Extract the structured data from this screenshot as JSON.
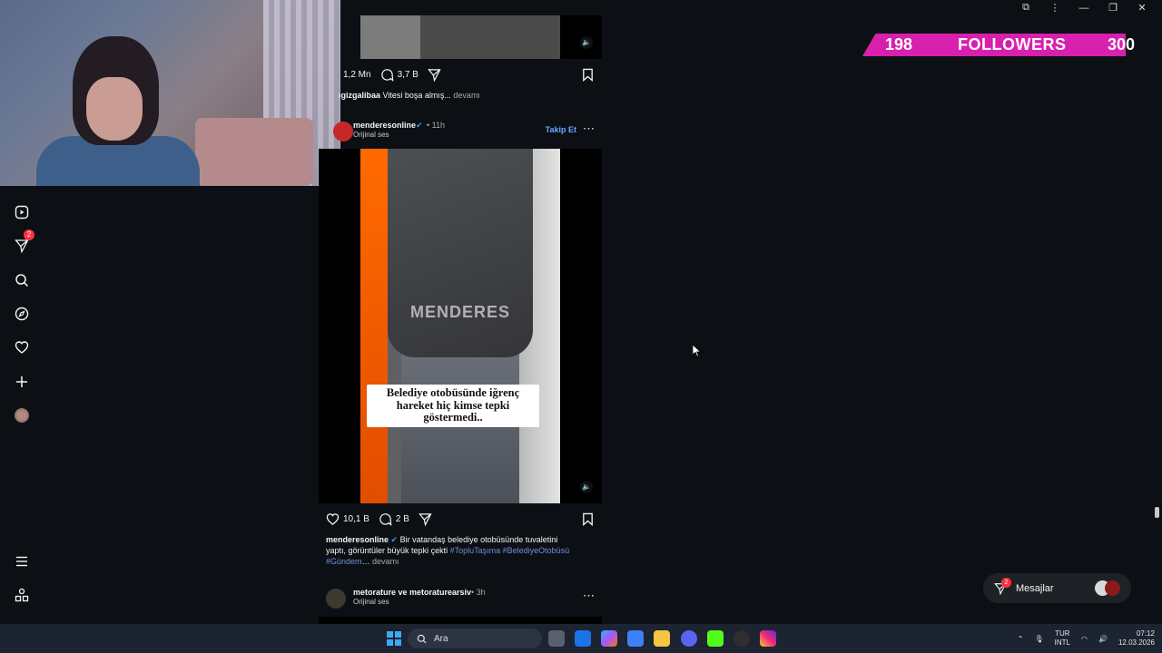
{
  "window_controls": {
    "extensions_icon": "puzzle-icon",
    "menu_icon": "kebab-icon",
    "minimize": "—",
    "restore": "❐",
    "close": "✕"
  },
  "followers_goal": {
    "current": "198",
    "label": "FOLLOWERS",
    "goal": "300",
    "bar_color": "#d81fae"
  },
  "left_nav": {
    "items": [
      {
        "name": "reels-icon"
      },
      {
        "name": "direct-icon",
        "badge": "2"
      },
      {
        "name": "search-icon"
      },
      {
        "name": "explore-icon"
      },
      {
        "name": "notifications-heart-icon"
      },
      {
        "name": "create-plus-icon"
      },
      {
        "name": "profile-avatar"
      }
    ],
    "bottom": [
      {
        "name": "more-menu-icon"
      },
      {
        "name": "also-from-meta-icon"
      }
    ]
  },
  "post_prev": {
    "likes": "1,2 Mn",
    "comments": "3,7 B",
    "caption_user": "ıgizgalibaa",
    "caption_text": "Vitesi boşa almış...",
    "more": "devamı"
  },
  "post_main": {
    "username": "menderesonline",
    "verified": true,
    "time": "11h",
    "audio": "Orijinal ses",
    "follow_label": "Takip Et",
    "watermark": "MENDERES",
    "sticker_text": "Belediye otobüsünde iğrenç hareket hiç kimse tepki göstermedi..",
    "likes": "10,1 B",
    "comments": "2 B",
    "caption_user": "menderesonline",
    "caption_text": "Bir vatandaş belediye otobüsünde tuvaletini yaptı, görüntüler büyük tepki çekti",
    "hashtags": "#TopluTaşıma #BelediyeOtobüsü #Gündem",
    "more": "devamı"
  },
  "post_next": {
    "users": "metorature ve metoraturearsiv",
    "time": "3h",
    "audio": "Orijinal ses"
  },
  "messages": {
    "label": "Mesajlar",
    "badge": "2"
  },
  "taskbar": {
    "search_placeholder": "Ara",
    "lang_top": "TUR",
    "lang_bottom": "INTL",
    "time": "07:12",
    "date": "12.03.2026"
  },
  "colors": {
    "background": "#0c1014",
    "accent_link": "#6aa7ff",
    "hashtag": "#6f8fd8",
    "badge": "#ff3040"
  }
}
